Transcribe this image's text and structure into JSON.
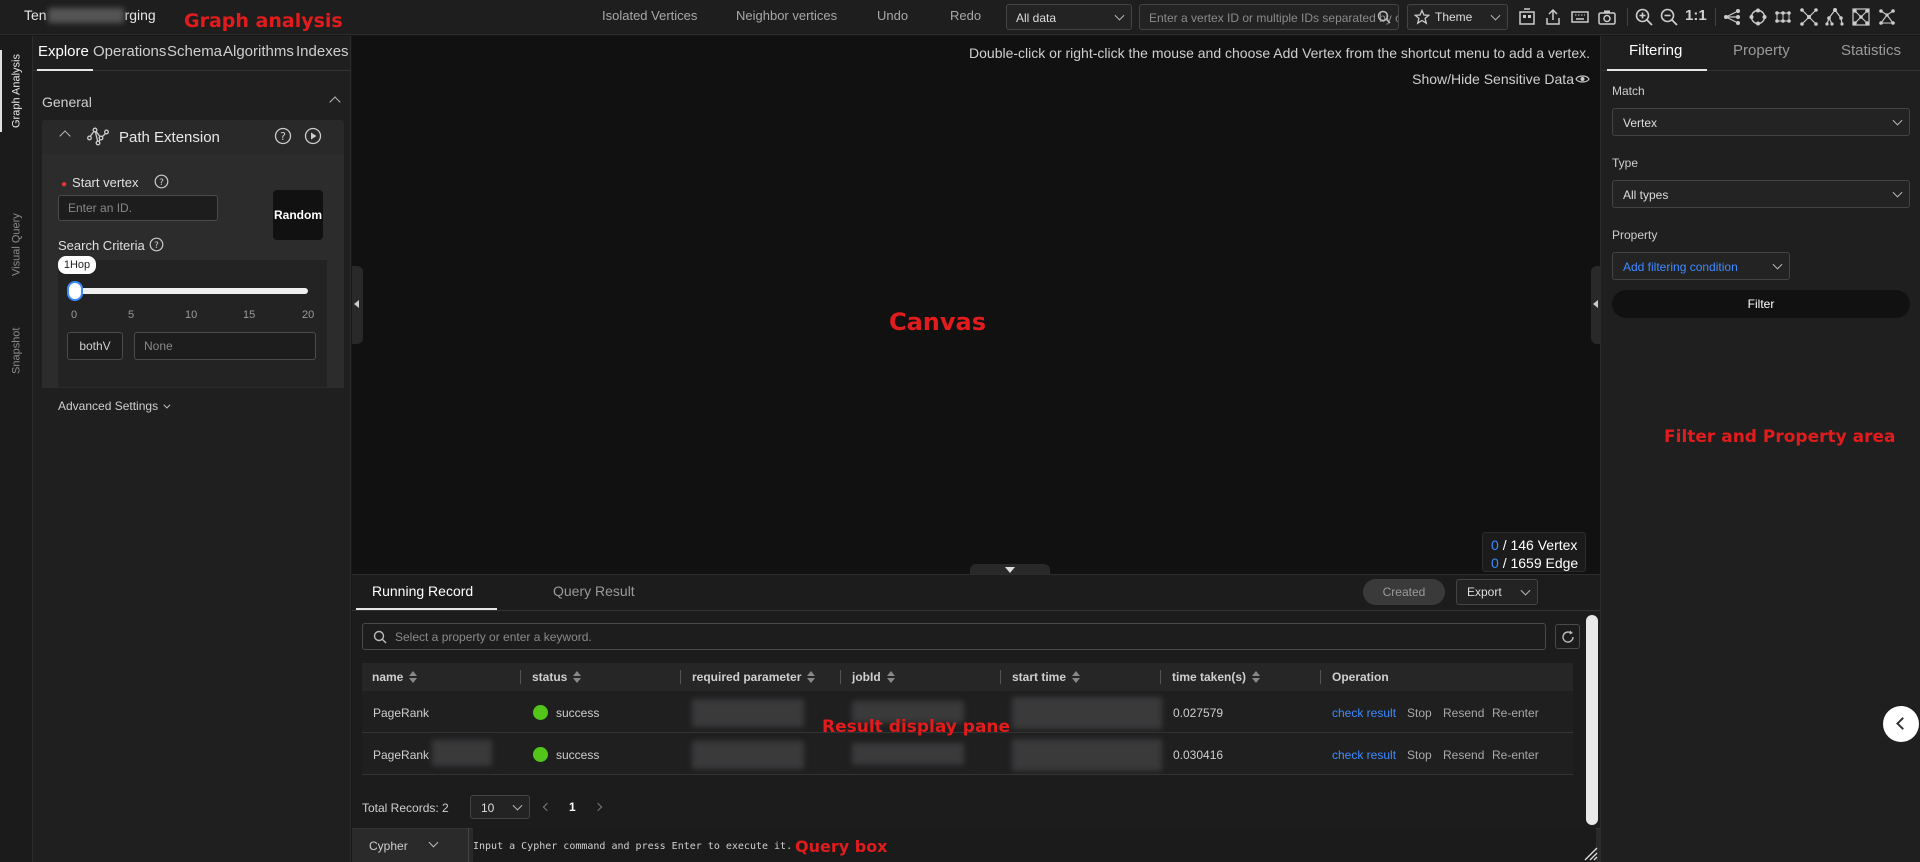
{
  "app": {
    "title_prefix": "Ten",
    "title_suffix": "rging",
    "annotation": "Graph analysis"
  },
  "toolbar": {
    "isolated_vertices": "Isolated Vertices",
    "neighbor_vertices": "Neighbor vertices",
    "undo": "Undo",
    "redo": "Redo",
    "data_select": "All data",
    "vertex_search_placeholder": "Enter a vertex ID or multiple IDs separated by commas",
    "theme": "Theme",
    "zoom_ratio": "1:1"
  },
  "rail": {
    "tabs": [
      "Graph Analysis",
      "Visual Query",
      "Snapshot"
    ]
  },
  "left_panel": {
    "tabs": [
      "Explore",
      "Operations",
      "Schema",
      "Algorithms",
      "Indexes"
    ],
    "section": "General",
    "algorithm": "Path Extension",
    "start_vertex_label": "Start vertex",
    "start_vertex_placeholder": "Enter an ID.",
    "random_button": "Random",
    "search_criteria_label": "Search Criteria",
    "hop_tooltip": "1Hop",
    "slider_value": 1,
    "slider_min": 0,
    "slider_max": 20,
    "slider_ticks": [
      "0",
      "5",
      "10",
      "15",
      "20"
    ],
    "direction": "bothV",
    "filter_placeholder": "None",
    "advanced_settings": "Advanced Settings"
  },
  "canvas": {
    "hint": "Double-click or right-click the mouse and choose Add Vertex from the shortcut menu to add a vertex.",
    "sensitive_toggle": "Show/Hide Sensitive Data",
    "annotation": "Canvas",
    "vertex_count": "0",
    "vertex_total": "/ 146 Vertex",
    "edge_count": "0",
    "edge_total": "/ 1659 Edge"
  },
  "result_pane": {
    "tabs": [
      "Running Record",
      "Query Result"
    ],
    "created_button": "Created",
    "export_button": "Export",
    "search_placeholder": "Select a property or enter a keyword.",
    "columns": [
      "name",
      "status",
      "required parameter",
      "jobId",
      "start time",
      "time taken(s)",
      "Operation"
    ],
    "rows": [
      {
        "name": "PageRank",
        "status": "success",
        "time_taken": "0.027579"
      },
      {
        "name": "PageRank",
        "status": "success",
        "time_taken": "0.030416"
      }
    ],
    "operations": [
      "check result",
      "Stop",
      "Resend",
      "Re-enter"
    ],
    "annotation": "Result display pane",
    "total_records": "Total Records: 2",
    "page_size": "10",
    "current_page": "1"
  },
  "query_box": {
    "language": "Cypher",
    "placeholder": "Input a Cypher command and press Enter to execute it.",
    "annotation": "Query box"
  },
  "right_panel": {
    "tabs": [
      "Filtering",
      "Property",
      "Statistics"
    ],
    "match_label": "Match",
    "match_value": "Vertex",
    "type_label": "Type",
    "type_value": "All types",
    "property_label": "Property",
    "add_condition": "Add filtering condition",
    "filter_button": "Filter",
    "annotation": "Filter and Property area"
  },
  "colors": {
    "accent": "#3d8bff",
    "success": "#52c41a",
    "annotation": "#e21c1c"
  }
}
